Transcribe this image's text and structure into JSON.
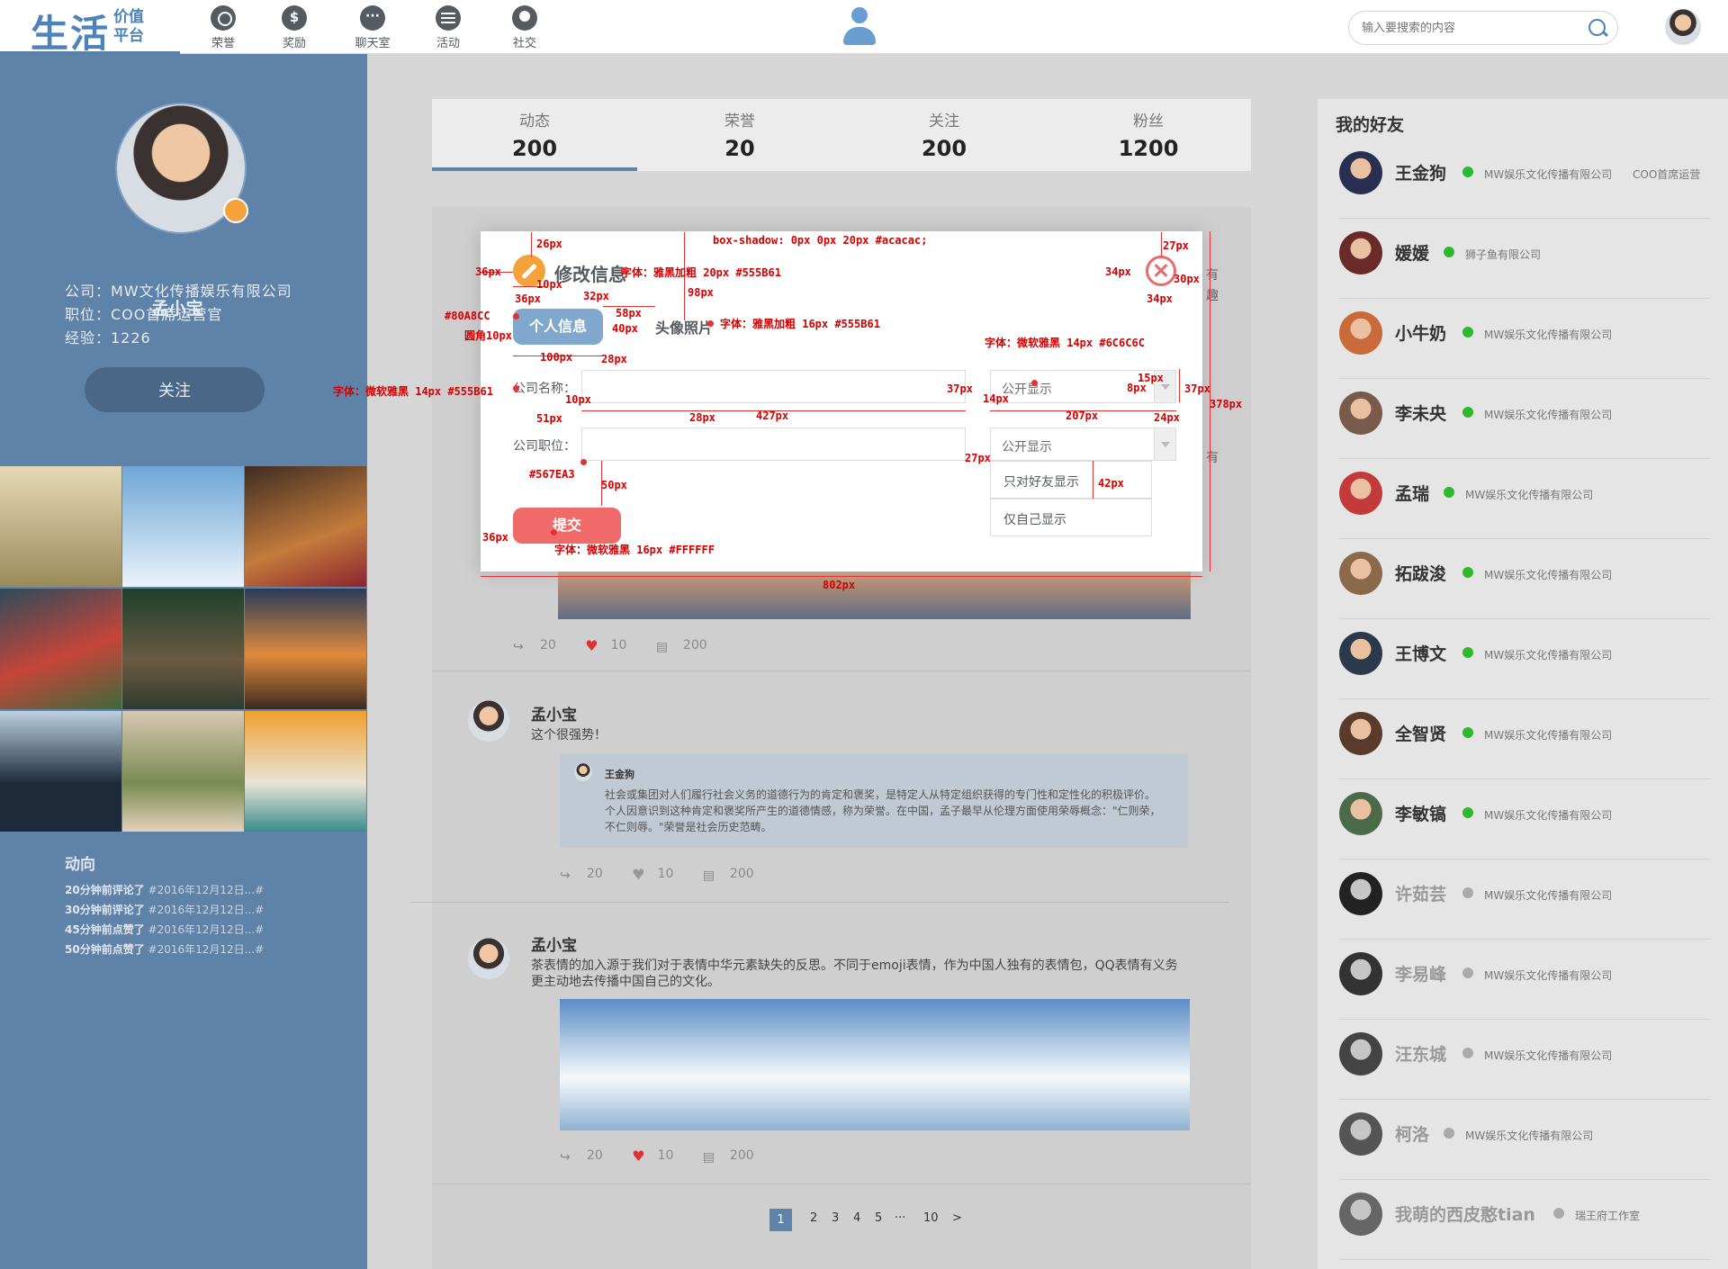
{
  "header": {
    "logo_main": "生活",
    "logo_sub1": "价值",
    "logo_sub2": "平台",
    "nav": [
      {
        "label": "荣誉",
        "icon": "trophy-icon"
      },
      {
        "label": "奖励",
        "icon": "money-bag-icon"
      },
      {
        "label": "聊天室",
        "icon": "chat-icon"
      },
      {
        "label": "活动",
        "icon": "calendar-icon"
      },
      {
        "label": "社交",
        "icon": "social-icon"
      }
    ],
    "search_placeholder": "输入要搜索的内容"
  },
  "profile": {
    "name": "孟小宝",
    "company": "公司：MW文化传播娱乐有限公司",
    "position": "职位：COO首席运营官",
    "experience": "经验：1226",
    "follow_label": "关注",
    "activity_title": "动向",
    "activities": [
      {
        "time": "20分钟前评论了",
        "target": "#2016年12月12日...#"
      },
      {
        "time": "30分钟前评论了",
        "target": "#2016年12月12日...#"
      },
      {
        "time": "45分钟前点赞了",
        "target": "#2016年12月12日...#"
      },
      {
        "time": "50分钟前点赞了",
        "target": "#2016年12月12日...#"
      }
    ]
  },
  "stats": [
    {
      "label": "动态",
      "value": "200"
    },
    {
      "label": "荣誉",
      "value": "20"
    },
    {
      "label": "关注",
      "value": "200"
    },
    {
      "label": "粉丝",
      "value": "1200"
    }
  ],
  "feed": {
    "post_stats": {
      "shares": "20",
      "likes": "10",
      "comments": "200"
    },
    "posts": [
      {
        "author": "孟小宝",
        "text": "这个很强势！",
        "quote_author": "王金狗",
        "quote_text": "社会或集团对人们履行社会义务的道德行为的肯定和褒奖，是特定人从特定组织获得的专门性和定性化的积极评价。个人因意识到这种肯定和褒奖所产生的道德情感，称为荣誉。在中国，孟子最早从伦理方面使用荣辱概念：\"仁则荣，不仁则辱。\"荣誉是社会历史范畴。"
      },
      {
        "author": "孟小宝",
        "text": "茶表情的加入源于我们对于表情中华元素缺失的反思。不同于emoji表情，作为中国人独有的表情包，QQ表情有义务更主动地去传播中国自己的文化。"
      }
    ],
    "behind_modal_text": [
      "有",
      "趣",
      "有"
    ]
  },
  "pagination": {
    "pages": [
      "1",
      "2",
      "3",
      "4",
      "5",
      "···",
      "10"
    ],
    "current": "1",
    "next": ">"
  },
  "friends": {
    "title": "我的好友",
    "list": [
      {
        "name": "王金狗",
        "online": true,
        "company": "MW娱乐文化传播有限公司",
        "title": "COO首席运营"
      },
      {
        "name": "媛媛",
        "online": true,
        "company": "狮子鱼有限公司",
        "title": ""
      },
      {
        "name": "小牛奶",
        "online": true,
        "company": "MW娱乐文化传播有限公司",
        "title": ""
      },
      {
        "name": "李未央",
        "online": true,
        "company": "MW娱乐文化传播有限公司",
        "title": ""
      },
      {
        "name": "孟瑞",
        "online": true,
        "company": "MW娱乐文化传播有限公司",
        "title": ""
      },
      {
        "name": "拓跋浚",
        "online": true,
        "company": "MW娱乐文化传播有限公司",
        "title": ""
      },
      {
        "name": "王博文",
        "online": true,
        "company": "MW娱乐文化传播有限公司",
        "title": ""
      },
      {
        "name": "全智贤",
        "online": true,
        "company": "MW娱乐文化传播有限公司",
        "title": ""
      },
      {
        "name": "李敏镐",
        "online": true,
        "company": "MW娱乐文化传播有限公司",
        "title": ""
      },
      {
        "name": "许茹芸",
        "online": false,
        "company": "MW娱乐文化传播有限公司",
        "title": ""
      },
      {
        "name": "李易峰",
        "online": false,
        "company": "MW娱乐文化传播有限公司",
        "title": ""
      },
      {
        "name": "汪东城",
        "online": false,
        "company": "MW娱乐文化传播有限公司",
        "title": ""
      },
      {
        "name": "柯洛",
        "online": false,
        "company": "MW娱乐文化传播有限公司",
        "title": ""
      },
      {
        "name": "我萌的西皮憨tian",
        "online": false,
        "company": "瑞王府工作室",
        "title": ""
      }
    ],
    "online_color": "#2eb82e",
    "offline_color": "#aaaaaa"
  },
  "modal": {
    "title": "修改信息",
    "tab_info": "个人信息",
    "tab_photo": "头像照片",
    "company_label": "公司名称：",
    "position_label": "公司职位：",
    "company_visibility": "公开显示",
    "position_visibility": "公开显示",
    "visibility_options": [
      "只对好友显示",
      "仅自己显示"
    ],
    "submit": "提交"
  },
  "annotations": {
    "shadow": "box-shadow: 0px 0px 20px #acacac;",
    "title_font": "字体：雅黑加粗 20px #555B61",
    "tab_font": "字体：雅黑加粗 16px #555B61",
    "select_font": "字体：微软雅黑 14px #6C6C6C",
    "label_font": "字体：微软雅黑 14px #555B61",
    "submit_font": "字体：微软雅黑 16px #FFFFFF",
    "tab_color": "#80A8CC",
    "tab_radius": "圆角10px",
    "submit_color": "#567EA3",
    "d26": "26px",
    "d36a": "36px",
    "d10a": "10px",
    "d36b": "36px",
    "d32": "32px",
    "d98": "98px",
    "d58": "58px",
    "d40": "40px",
    "d100": "100px",
    "d28a": "28px",
    "d10b": "10px",
    "d51": "51px",
    "d28b": "28px",
    "d427": "427px",
    "d37a": "37px",
    "d14": "14px",
    "d15": "15px",
    "d8": "8px",
    "d37b": "37px",
    "d378": "378px",
    "d207": "207px",
    "d24": "24px",
    "d27a": "27px",
    "d50": "50px",
    "d42": "42px",
    "d36c": "36px",
    "d802": "802px",
    "d27b": "27px",
    "d34a": "34px",
    "d30": "30px",
    "d34b": "34px"
  },
  "colors": {
    "primary": "#5f83a8",
    "accent": "#f16a6a",
    "text": "#555B61"
  }
}
